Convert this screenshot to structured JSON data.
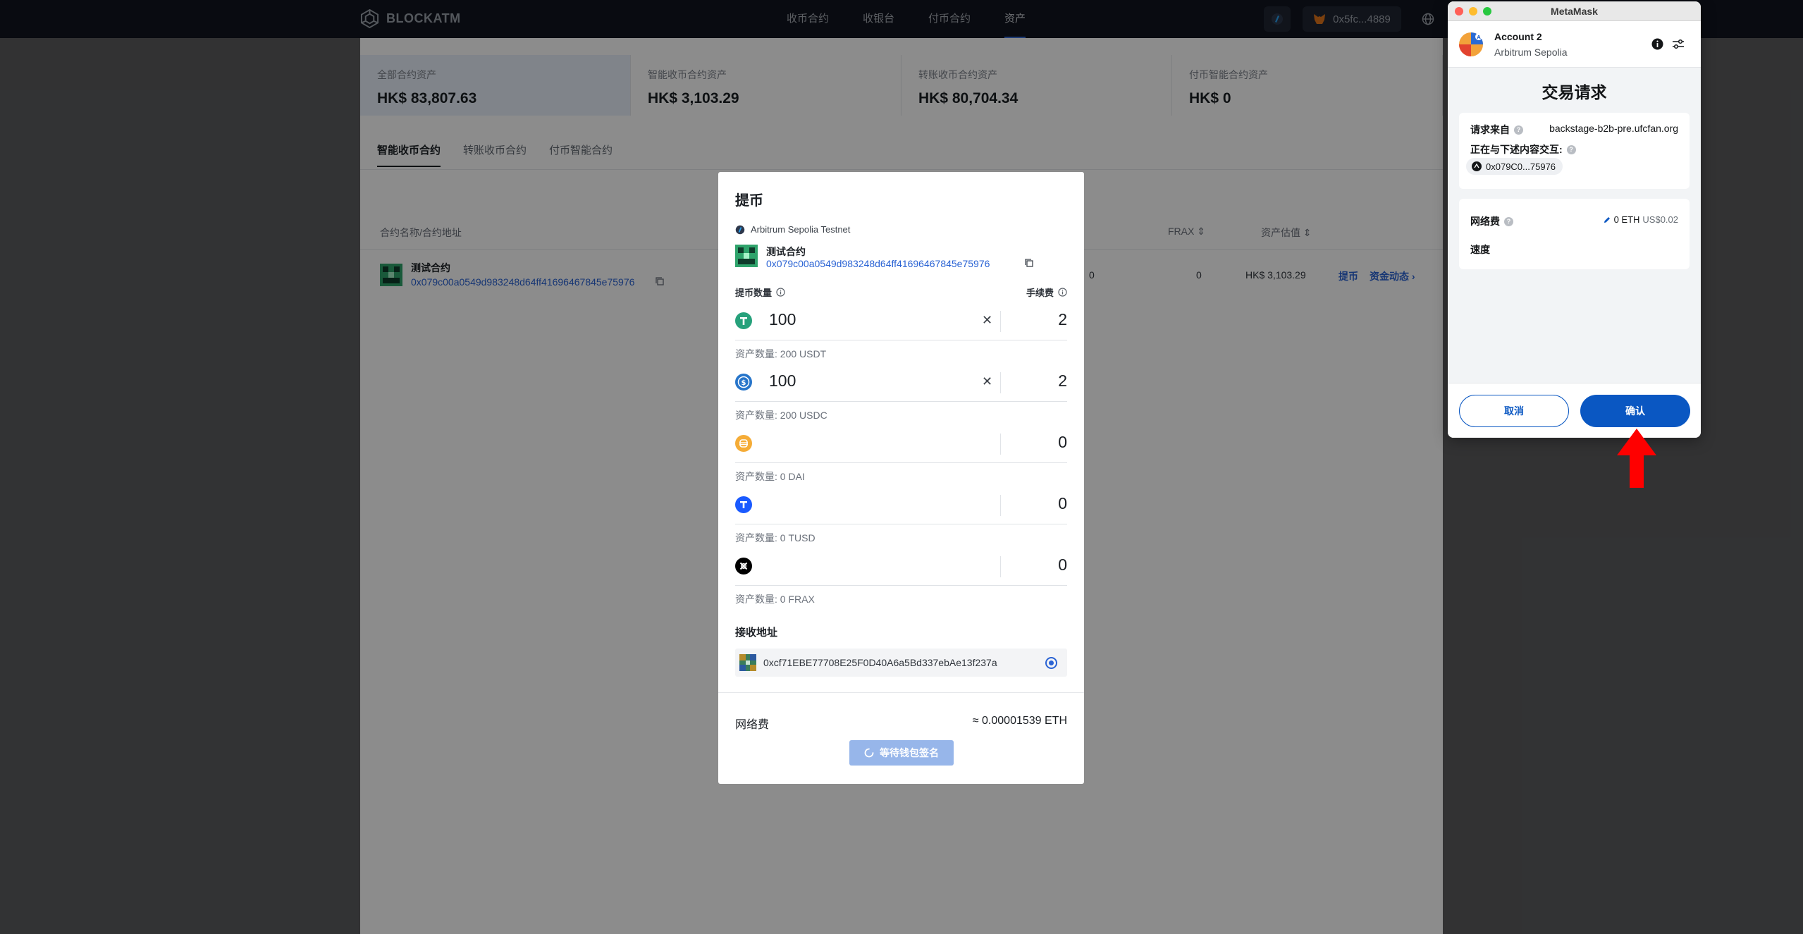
{
  "nav": {
    "brand": "BLOCKATM",
    "links": [
      "收币合约",
      "收银台",
      "付币合约",
      "资产"
    ],
    "wallet_address": "0x5fc...4889"
  },
  "stats": [
    {
      "label": "全部合约资产",
      "value": "HK$ 83,807.63"
    },
    {
      "label": "智能收币合约资产",
      "value": "HK$ 3,103.29"
    },
    {
      "label": "转账收币合约资产",
      "value": "HK$ 80,704.34"
    },
    {
      "label": "付币智能合约资产",
      "value": "HK$ 0"
    }
  ],
  "tabs": [
    "智能收币合约",
    "转账收币合约",
    "付币智能合约"
  ],
  "table": {
    "col_name": "合约名称/合约地址",
    "col_frax": "FRAX",
    "col_value": "资产估值",
    "row": {
      "name": "测试合约",
      "address": "0x079c00a0549d983248d64ff41696467845e75976",
      "cell_a": "0",
      "frax": "0",
      "value": "HK$ 3,103.29",
      "withdraw_link": "提币",
      "history_link": "资金动态"
    }
  },
  "modal": {
    "title": "提币",
    "network": "Arbitrum Sepolia Testnet",
    "contract_name": "测试合约",
    "contract_address": "0x079c00a0549d983248d64ff41696467845e75976",
    "amount_label": "提币数量",
    "fee_label": "手续费",
    "tokens": [
      {
        "icon": "usdt-icon",
        "amount": "100",
        "fee": "2",
        "balance": "资产数量: 200 USDT",
        "color": "#26a17b"
      },
      {
        "icon": "usdc-icon",
        "amount": "100",
        "fee": "2",
        "balance": "资产数量: 200 USDC",
        "color": "#2775ca"
      },
      {
        "icon": "dai-icon",
        "amount": "",
        "fee": "0",
        "balance": "资产数量: 0 DAI",
        "color": "#f5ac37"
      },
      {
        "icon": "tusd-icon",
        "amount": "",
        "fee": "0",
        "balance": "资产数量: 0 TUSD",
        "color": "#1a5aff"
      },
      {
        "icon": "frax-icon",
        "amount": "",
        "fee": "0",
        "balance": "资产数量: 0 FRAX",
        "color": "#000000"
      }
    ],
    "receive_label": "接收地址",
    "receive_address": "0xcf71EBE77708E25F0D40A6a5Bd337ebAe13f237a",
    "network_fee_label": "网络费",
    "network_fee_value": "≈ 0.00001539 ETH",
    "waiting_button": "等待钱包签名"
  },
  "metamask": {
    "window_title": "MetaMask",
    "account": "Account 2",
    "network": "Arbitrum Sepolia",
    "heading": "交易请求",
    "request_from_label": "请求来自",
    "request_origin": "backstage-b2b-pre.ufcfan.org",
    "interacting_label": "正在与下述内容交互:",
    "interacting_address": "0x079C0...75976",
    "gas_label": "网络费",
    "gas_eth": "0 ETH",
    "gas_fiat": "US$0.02",
    "speed_label": "速度",
    "cancel_button": "取消",
    "confirm_button": "确认"
  },
  "colors": {
    "accent": "#2a63d4",
    "metamask_primary": "#0a57c2",
    "annotation_arrow": "#ff0000"
  }
}
